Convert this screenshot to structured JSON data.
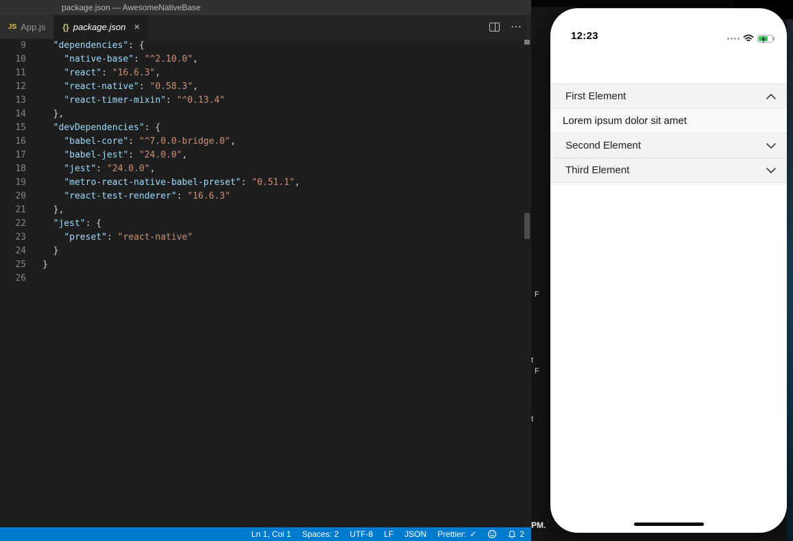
{
  "window": {
    "title": "package.json — AwesomeNativeBase",
    "tabs": [
      {
        "label": "App.js",
        "icon_text": "JS"
      },
      {
        "label": "package.json",
        "icon_text": "{}",
        "close_label": "×"
      }
    ],
    "actions": {
      "more_label": "⋯"
    }
  },
  "editor": {
    "lines": [
      {
        "n": "9",
        "tk": [
          [
            "ws",
            "  "
          ],
          [
            "k",
            "\"dependencies\""
          ],
          [
            "p",
            ": {"
          ]
        ]
      },
      {
        "n": "10",
        "tk": [
          [
            "ws",
            "    "
          ],
          [
            "k",
            "\"native-base\""
          ],
          [
            "p",
            ": "
          ],
          [
            "s",
            "\"^2.10.0\""
          ],
          [
            "p",
            ","
          ]
        ]
      },
      {
        "n": "11",
        "tk": [
          [
            "ws",
            "    "
          ],
          [
            "k",
            "\"react\""
          ],
          [
            "p",
            ": "
          ],
          [
            "s",
            "\"16.6.3\""
          ],
          [
            "p",
            ","
          ]
        ]
      },
      {
        "n": "12",
        "tk": [
          [
            "ws",
            "    "
          ],
          [
            "k",
            "\"react-native\""
          ],
          [
            "p",
            ": "
          ],
          [
            "s",
            "\"0.58.3\""
          ],
          [
            "p",
            ","
          ]
        ]
      },
      {
        "n": "13",
        "tk": [
          [
            "ws",
            "    "
          ],
          [
            "k",
            "\"react-timer-mixin\""
          ],
          [
            "p",
            ": "
          ],
          [
            "s",
            "\"^0.13.4\""
          ]
        ]
      },
      {
        "n": "14",
        "tk": [
          [
            "ws",
            "  "
          ],
          [
            "p",
            "},"
          ]
        ]
      },
      {
        "n": "15",
        "tk": [
          [
            "ws",
            "  "
          ],
          [
            "k",
            "\"devDependencies\""
          ],
          [
            "p",
            ": {"
          ]
        ]
      },
      {
        "n": "16",
        "tk": [
          [
            "ws",
            "    "
          ],
          [
            "k",
            "\"babel-core\""
          ],
          [
            "p",
            ": "
          ],
          [
            "s",
            "\"^7.0.0-bridge.0\""
          ],
          [
            "p",
            ","
          ]
        ]
      },
      {
        "n": "17",
        "tk": [
          [
            "ws",
            "    "
          ],
          [
            "k",
            "\"babel-jest\""
          ],
          [
            "p",
            ": "
          ],
          [
            "s",
            "\"24.0.0\""
          ],
          [
            "p",
            ","
          ]
        ]
      },
      {
        "n": "18",
        "tk": [
          [
            "ws",
            "    "
          ],
          [
            "k",
            "\"jest\""
          ],
          [
            "p",
            ": "
          ],
          [
            "s",
            "\"24.0.0\""
          ],
          [
            "p",
            ","
          ]
        ]
      },
      {
        "n": "19",
        "tk": [
          [
            "ws",
            "    "
          ],
          [
            "k",
            "\"metro-react-native-babel-preset\""
          ],
          [
            "p",
            ": "
          ],
          [
            "s",
            "\"0.51.1\""
          ],
          [
            "p",
            ","
          ]
        ]
      },
      {
        "n": "20",
        "tk": [
          [
            "ws",
            "    "
          ],
          [
            "k",
            "\"react-test-renderer\""
          ],
          [
            "p",
            ": "
          ],
          [
            "s",
            "\"16.6.3\""
          ]
        ]
      },
      {
        "n": "21",
        "tk": [
          [
            "ws",
            "  "
          ],
          [
            "p",
            "},"
          ]
        ]
      },
      {
        "n": "22",
        "tk": [
          [
            "ws",
            "  "
          ],
          [
            "k",
            "\"jest\""
          ],
          [
            "p",
            ": {"
          ]
        ]
      },
      {
        "n": "23",
        "tk": [
          [
            "ws",
            "    "
          ],
          [
            "k",
            "\"preset\""
          ],
          [
            "p",
            ": "
          ],
          [
            "s",
            "\"react-native\""
          ]
        ]
      },
      {
        "n": "24",
        "tk": [
          [
            "ws",
            "  "
          ],
          [
            "p",
            "}"
          ]
        ]
      },
      {
        "n": "25",
        "tk": [
          [
            "p",
            "}"
          ]
        ]
      },
      {
        "n": "26",
        "tk": []
      }
    ]
  },
  "status_bar": {
    "cursor": "Ln 1, Col 1",
    "indent": "Spaces: 2",
    "encoding": "UTF-8",
    "eol": "LF",
    "language": "JSON",
    "prettier_label": "Prettier:",
    "prettier_check": "✓",
    "notification_count": "2"
  },
  "simulator": {
    "time": "12:23",
    "accordion": {
      "first_label": "First Element",
      "first_content": "Lorem ipsum dolor sit amet",
      "second_label": "Second Element",
      "third_label": "Third Element"
    }
  },
  "desktop_fragments": {
    "f1": "F",
    "f2": "t",
    "f3": "F",
    "f4": "t",
    "f5": "PM."
  },
  "colors": {
    "status_bar": "#007acc",
    "editor_bg": "#1e1e1e",
    "json_key": "#9cdcfe",
    "json_string": "#ce9178",
    "battery_green": "#35c759"
  }
}
